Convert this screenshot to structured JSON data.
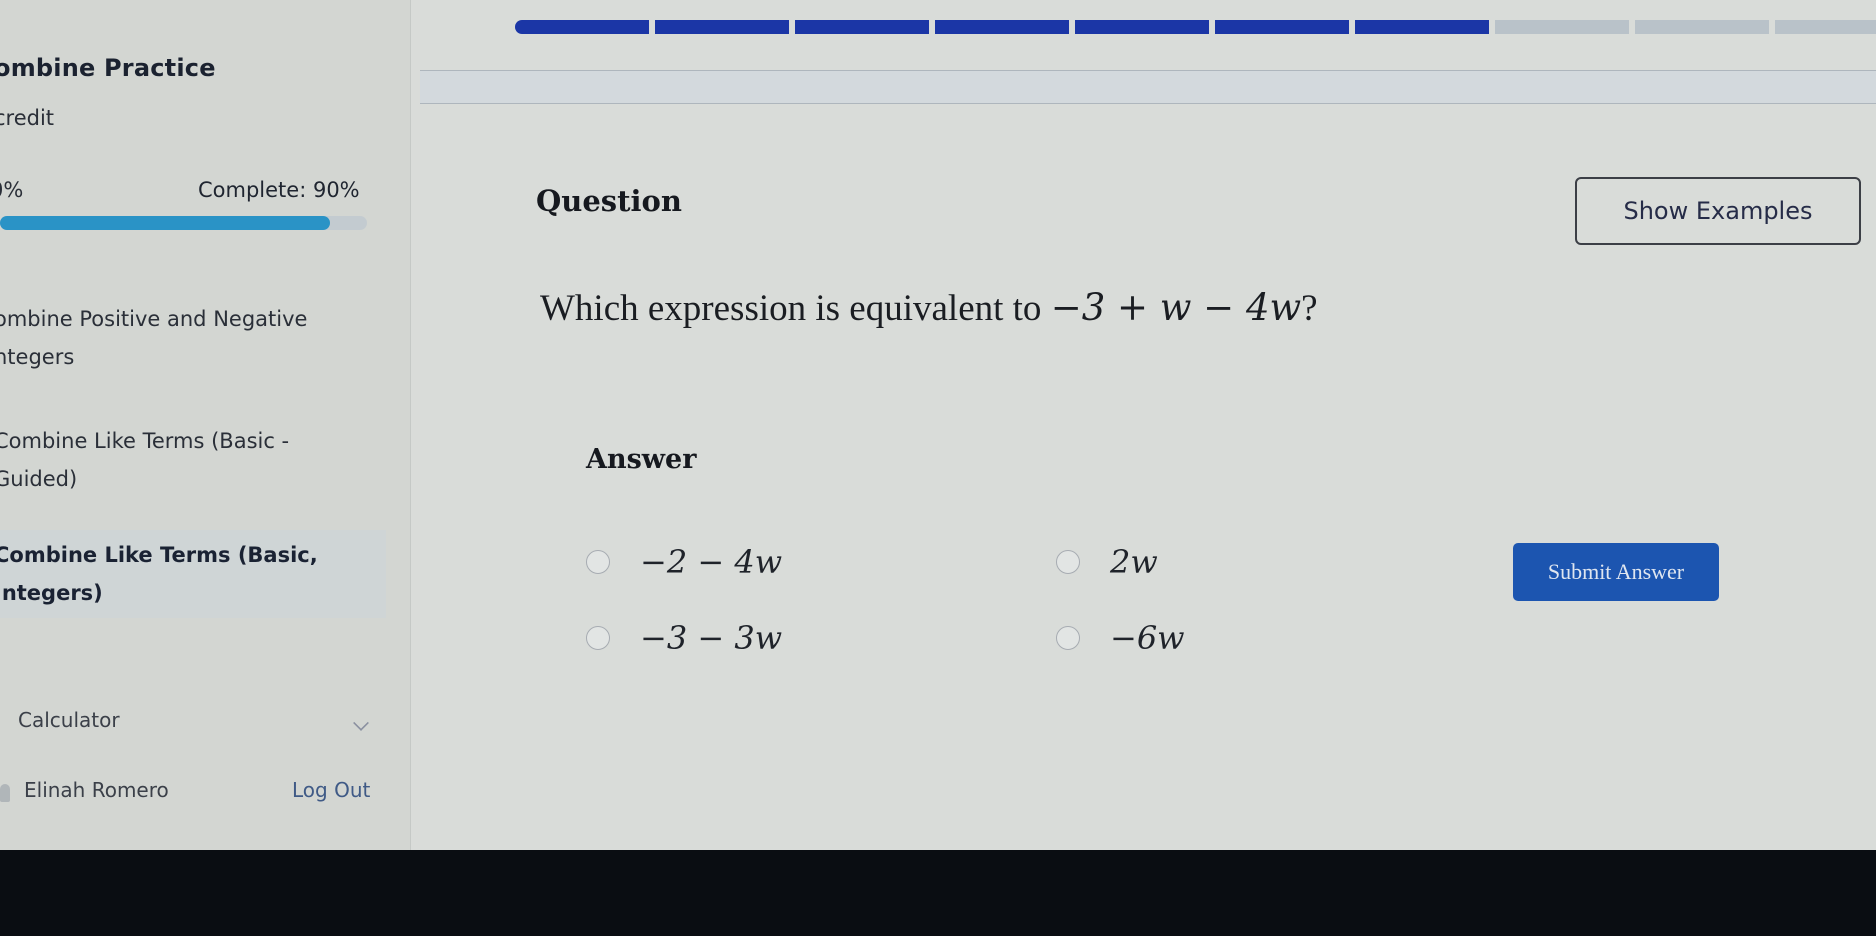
{
  "sidebar": {
    "course_title": "ombine Practice",
    "credit_label": "credit",
    "progress_left": "0%",
    "progress_label": "Complete: 90%",
    "progress_value": 0.9,
    "lessons": [
      {
        "label_line1": "ombine Positive and Negative",
        "label_line2": "ntegers",
        "active": false
      },
      {
        "label_line1": "Combine Like Terms (Basic -",
        "label_line2": "Guided)",
        "active": false
      },
      {
        "label_line1": "Combine Like Terms (Basic,",
        "label_line2": "Integers)",
        "active": true
      }
    ],
    "calculator_label": "Calculator",
    "user_name": "Elinah Romero",
    "logout_label": "Log Out"
  },
  "question_progress": {
    "total_segments": 10,
    "completed_segments": 7
  },
  "main": {
    "question_heading": "Question",
    "show_examples_label": "Show Examples",
    "question_prefix": "Which expression is equivalent to",
    "question_expression": "−3 + w − 4w",
    "question_suffix": "?",
    "answer_heading": "Answer",
    "choices": [
      {
        "label": "−2 − 4w",
        "selected": false
      },
      {
        "label": "2w",
        "selected": false
      },
      {
        "label": "−3 − 3w",
        "selected": false
      },
      {
        "label": "−6w",
        "selected": false
      }
    ],
    "submit_label": "Submit Answer"
  },
  "colors": {
    "segment_done": "#1b36a6",
    "segment_todo": "#b9c2c9",
    "progress_fill": "#2a93c6",
    "submit_bg": "#1c55b0",
    "logout_link": "#3f5a86"
  }
}
